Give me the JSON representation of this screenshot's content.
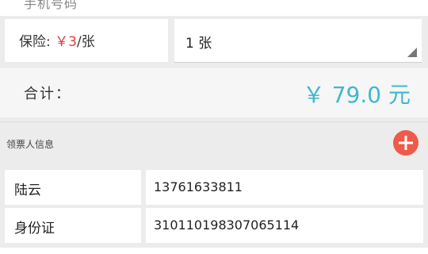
{
  "header_partial": {
    "text": "手机号码"
  },
  "insurance": {
    "label_prefix": "保险: ",
    "price": "￥3",
    "label_suffix": "/张",
    "selected": "1 张"
  },
  "total": {
    "label": "合计：",
    "value": "￥ 79.0 元"
  },
  "ticket_holder_section": {
    "title": "领票人信息",
    "add_icon": "plus-circle-icon"
  },
  "ticket_holder": {
    "rows": [
      {
        "label": "陆云",
        "value": "13761633811"
      },
      {
        "label": "身份证",
        "value": "310110198307065114"
      }
    ]
  },
  "colors": {
    "accent": "#3fb8cf",
    "price_red": "#e23b3b",
    "add_button": "#ef5a4a"
  }
}
